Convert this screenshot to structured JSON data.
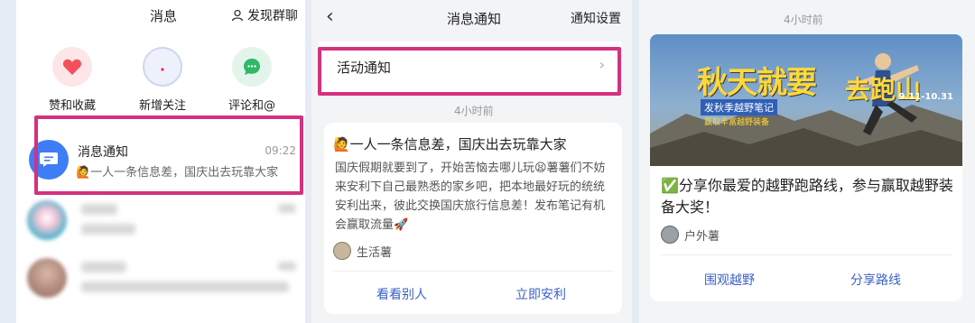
{
  "panel1": {
    "title": "消息",
    "discover_label": "发现群聊",
    "quick_actions": [
      {
        "label": "赞和收藏",
        "icon": "heart-icon"
      },
      {
        "label": "新增关注",
        "icon": "new-follower-icon"
      },
      {
        "label": "评论和@",
        "icon": "comment-icon"
      }
    ],
    "notification": {
      "title": "消息通知",
      "time": "09:22",
      "preview": "🙋一人一条信息差，国庆出去玩靠大家"
    }
  },
  "panel2": {
    "title": "消息通知",
    "settings_label": "通知设置",
    "activity_label": "活动通知",
    "timestamp": "4小时前",
    "card": {
      "heading": "🙋一人一条信息差，国庆出去玩靠大家",
      "body": "国庆假期就要到了，开始苦恼去哪儿玩😫薯薯们不妨来安利下自己最熟悉的家乡吧，把本地最好玩的统统安利出来，彼此交换国庆旅行信息差！发布笔记有机会赢取流量🚀",
      "source": "生活薯",
      "actions": [
        "看看别人",
        "立即安利"
      ]
    }
  },
  "panel3": {
    "timestamp": "4小时前",
    "banner": {
      "title": "秋天就要",
      "run_text": "去跑山",
      "subtitle": "发秋季越野笔记",
      "subtitle2": "赢取丰富越野装备",
      "date": "9.11-10.31"
    },
    "card": {
      "heading": "✅分享你最爱的越野跑路线，参与赢取越野装备大奖！",
      "source": "户外薯",
      "actions": [
        "围观越野",
        "分享路线"
      ]
    }
  },
  "colors": {
    "highlight": "#d4317e",
    "accent_blue": "#3e7df7",
    "link_blue": "#3b62c4"
  }
}
